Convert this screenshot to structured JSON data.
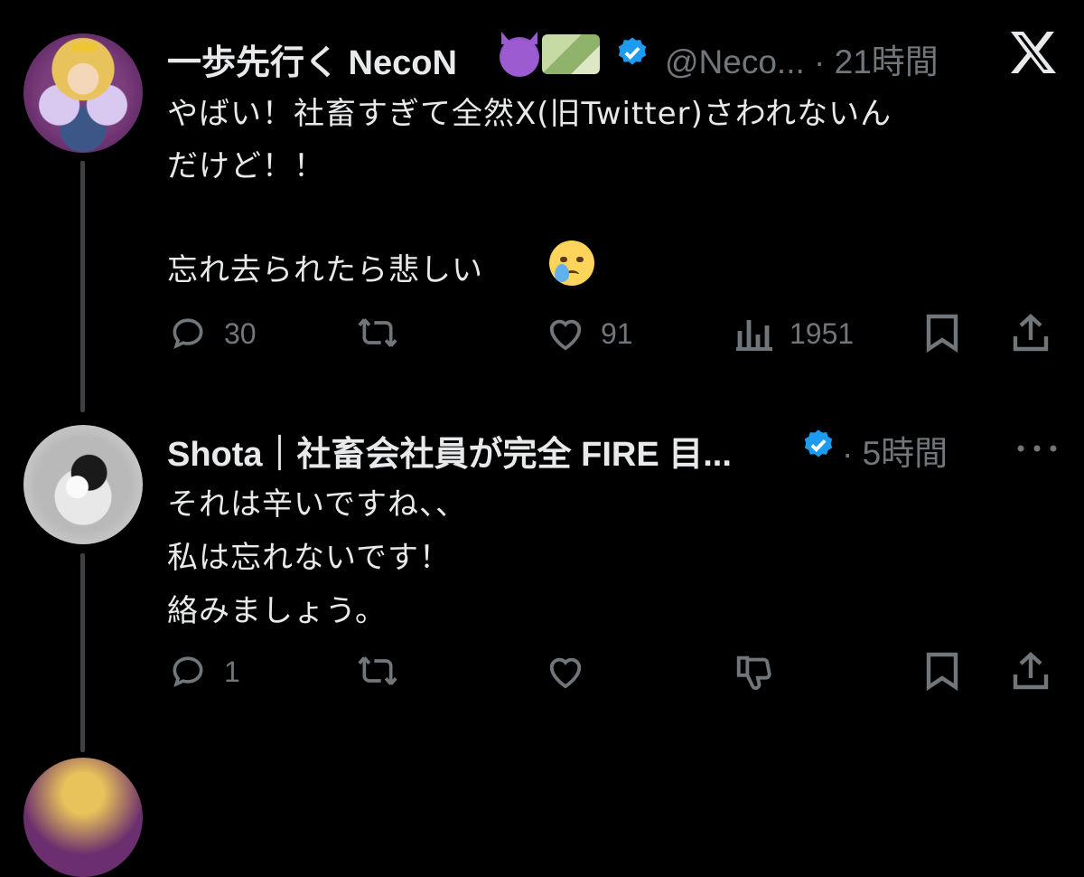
{
  "tweet1": {
    "display_name": "一歩先行く NecoN",
    "handle_time": "@Neco... · 21時間",
    "lines": [
      "やばい！社畜すぎて全然X(旧Twitter)さわれないん",
      "だけど！！",
      "忘れ去られたら悲しい"
    ],
    "actions": {
      "replies": "30",
      "likes": "91",
      "views": "1951"
    }
  },
  "tweet2": {
    "display_name": "Shota｜社畜会社員が完全 FIRE 目...",
    "time": "· 5時間",
    "lines": [
      "それは辛いですね、、",
      "私は忘れないです！",
      "絡みましょう。"
    ],
    "actions": {
      "replies": "1"
    }
  },
  "icons": {
    "emoji_1": "smiling-devil-icon",
    "emoji_2": "money-with-wings-icon",
    "emoji_3": "crying-face-icon",
    "brand": "x-logo-icon",
    "more": "more-icon"
  },
  "colors": {
    "background": "#000000",
    "text": "#e7e9ea",
    "muted": "#71767b",
    "verified": "#1d9bf0",
    "thread_line": "#3e4144"
  }
}
